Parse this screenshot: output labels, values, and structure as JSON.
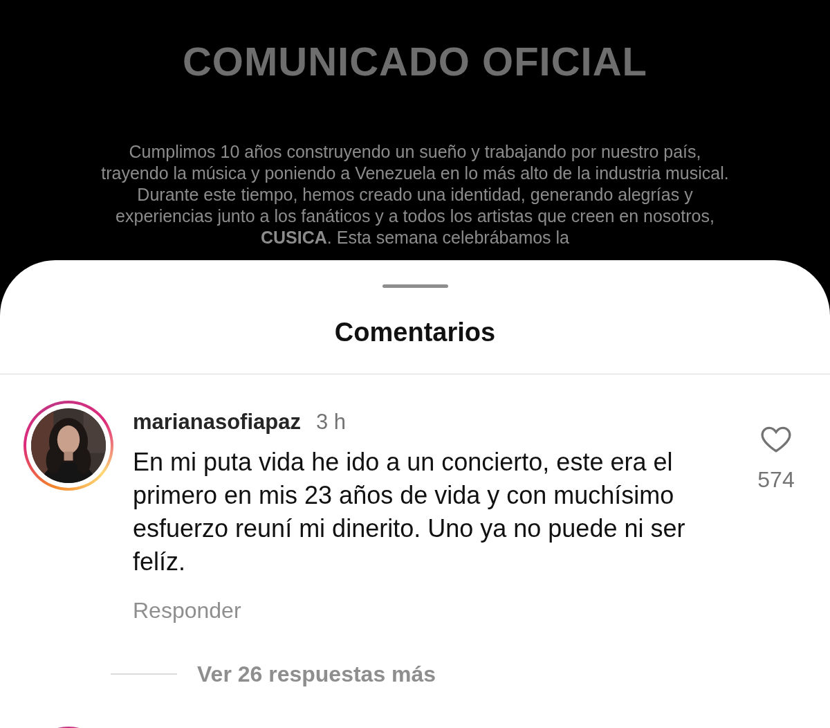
{
  "post": {
    "title": "COMUNICADO OFICIAL",
    "body": "Cumplimos 10 años construyendo un sueño y trabajando por nuestro país, trayendo la música y poniendo a Venezuela en lo más alto de la industria musical. Durante este tiempo, hemos creado una identidad, generando alegrías y experiencias junto a los fanáticos y a todos los artistas que creen en nosotros, **CUSICA**. Esta semana celebrábamos la"
  },
  "sheet": {
    "title": "Comentarios",
    "comments": [
      {
        "username": "marianasofiapaz",
        "time": "3 h",
        "text": "En mi puta vida he ido a un concierto, este era el primero en mis 23 años de vida y con muchísimo esfuerzo reuní mi dinerito. Uno ya no puede ni ser felíz.",
        "likes": "574",
        "reply": "Responder",
        "more_replies": "Ver 26 respuestas más"
      }
    ]
  }
}
